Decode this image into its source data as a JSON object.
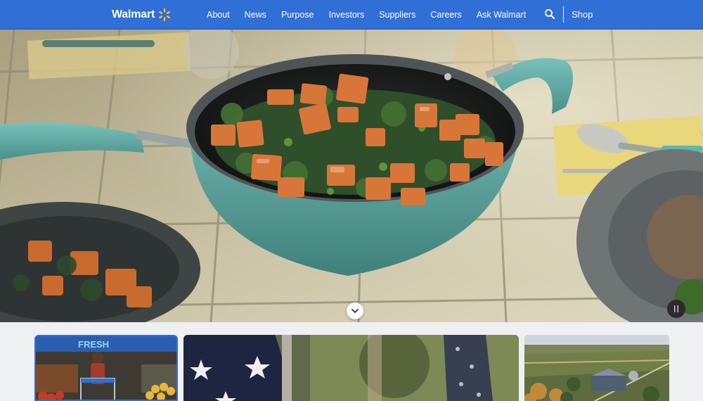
{
  "header": {
    "logo_text": "Walmart",
    "logo_icon": "spark-icon",
    "nav": [
      {
        "label": "About"
      },
      {
        "label": "News"
      },
      {
        "label": "Purpose"
      },
      {
        "label": "Investors"
      },
      {
        "label": "Suppliers"
      },
      {
        "label": "Careers"
      },
      {
        "label": "Ask Walmart"
      }
    ],
    "search_icon": "search-icon",
    "shop_label": "Shop",
    "colors": {
      "bar": "#2f6fd6",
      "spark": "#ffc220"
    }
  },
  "hero": {
    "scroll_icon": "chevron-down-icon",
    "pause_icon": "pause-icon"
  },
  "cards": [
    {
      "image": "store-associate-photo",
      "sign_text": "FRESH"
    },
    {
      "image": "american-flag-photo"
    },
    {
      "image": "aerial-farmland-photo"
    }
  ]
}
